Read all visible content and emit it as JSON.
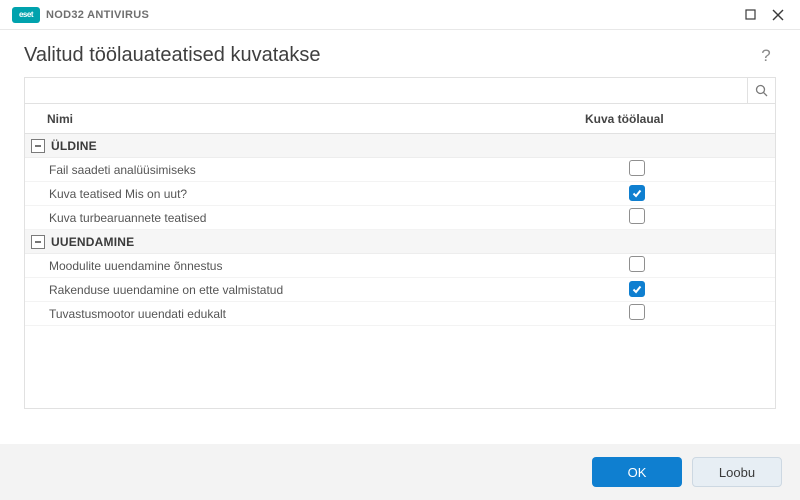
{
  "brand": {
    "badge": "eset",
    "product": "NOD32 ANTIVIRUS"
  },
  "page": {
    "title": "Valitud töölauateatised kuvatakse"
  },
  "search": {
    "placeholder": ""
  },
  "columns": {
    "name": "Nimi",
    "show": "Kuva töölaual"
  },
  "groups": [
    {
      "title": "ÜLDINE",
      "items": [
        {
          "label": "Fail saadeti analüüsimiseks",
          "checked": false
        },
        {
          "label": "Kuva teatised Mis on uut?",
          "checked": true
        },
        {
          "label": "Kuva turbearuannete teatised",
          "checked": false
        }
      ]
    },
    {
      "title": "UUENDAMINE",
      "items": [
        {
          "label": "Moodulite uuendamine õnnestus",
          "checked": false
        },
        {
          "label": "Rakenduse uuendamine on ette valmistatud",
          "checked": true
        },
        {
          "label": "Tuvastusmootor uuendati edukalt",
          "checked": false
        }
      ]
    }
  ],
  "buttons": {
    "ok": "OK",
    "cancel": "Loobu"
  }
}
